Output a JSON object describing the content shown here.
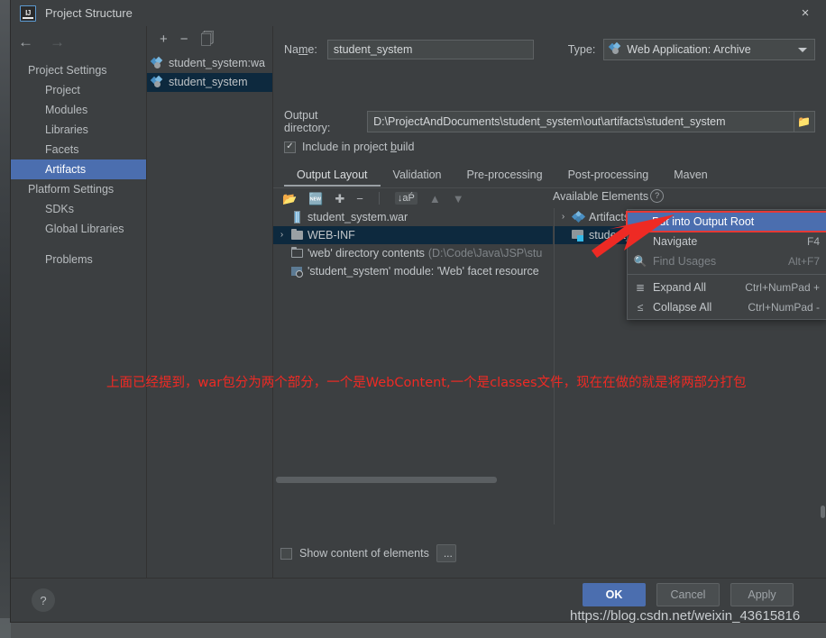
{
  "window": {
    "title": "Project Structure",
    "app_icon": "intellij-idea-icon",
    "close_label": "×"
  },
  "nav": {
    "back_icon": "arrow-left-icon",
    "forward_icon": "arrow-right-icon",
    "items": [
      {
        "label": "Project Settings",
        "type": "group",
        "selected": false
      },
      {
        "label": "Project",
        "type": "child",
        "selected": false
      },
      {
        "label": "Modules",
        "type": "child",
        "selected": false
      },
      {
        "label": "Libraries",
        "type": "child",
        "selected": false
      },
      {
        "label": "Facets",
        "type": "child",
        "selected": false
      },
      {
        "label": "Artifacts",
        "type": "child",
        "selected": true
      },
      {
        "label": "Platform Settings",
        "type": "group",
        "selected": false
      },
      {
        "label": "SDKs",
        "type": "child",
        "selected": false
      },
      {
        "label": "Global Libraries",
        "type": "child",
        "selected": false
      },
      {
        "label": "Problems",
        "type": "child",
        "selected": false
      }
    ]
  },
  "artifacts_panel": {
    "toolbar": {
      "add": "+",
      "remove": "−",
      "copy": "copy-icon"
    },
    "items": [
      {
        "label": "student_system:wa",
        "selected": false
      },
      {
        "label": "student_system",
        "selected": true
      }
    ]
  },
  "form": {
    "name_label": "Na",
    "name_label_underline": "m",
    "name_label_rest": "e:",
    "name_value": "student_system",
    "type_label": "Type:",
    "type_value": "Web Application: Archive",
    "output_dir_label": "Output directory:",
    "output_dir_value": "D:\\ProjectAndDocuments\\student_system\\out\\artifacts\\student_system",
    "browse_icon": "folder-browse-icon",
    "include_checkbox_checked": true,
    "include_label_pre": "Include in project ",
    "include_label_mnemonic": "b",
    "include_label_post": "uild"
  },
  "tabs": [
    {
      "label": "Output Layout",
      "active": true
    },
    {
      "label": "Validation",
      "active": false
    },
    {
      "label": "Pre-processing",
      "active": false
    },
    {
      "label": "Post-processing",
      "active": false
    },
    {
      "label": "Maven",
      "active": false
    }
  ],
  "layout_toolbar": {
    "add_dir_icon": "add-directory-icon",
    "add_archive_icon": "add-archive-icon",
    "plus_icon": "plus-icon",
    "minus_icon": "minus-icon",
    "sort_icon": "sort-az-icon",
    "up_icon": "move-up-icon",
    "down_icon": "move-down-icon",
    "available_elements_label": "Available Elements",
    "help_icon": "question-mark-icon"
  },
  "output_tree": [
    {
      "label": "student_system.war",
      "suffix": "",
      "icon": "jar-icon",
      "indent": 0,
      "chevron": "",
      "selected": false
    },
    {
      "label": "WEB-INF",
      "suffix": "",
      "icon": "folder-icon",
      "indent": 0,
      "chevron": "›",
      "selected": true
    },
    {
      "label": "'web' directory contents",
      "suffix": "(D:\\Code\\Java\\JSP\\stu",
      "icon": "folder-open-icon",
      "indent": 1,
      "chevron": "",
      "selected": false
    },
    {
      "label": "'student_system' module: 'Web' facet resource",
      "suffix": "",
      "icon": "facet-icon",
      "indent": 1,
      "chevron": "",
      "selected": false
    }
  ],
  "available_tree": [
    {
      "label": "Artifacts",
      "icon": "artifact-icon",
      "chevron": "›",
      "selected": false
    },
    {
      "label": "student_s",
      "icon": "module-folder-icon",
      "chevron": "",
      "selected": true
    }
  ],
  "context_menu": {
    "items": [
      {
        "label": "Put into Output Root",
        "key": "",
        "icon": "",
        "highlight": true,
        "disabled": false,
        "separator_after": false
      },
      {
        "label": "Navigate",
        "key": "F4",
        "icon": "",
        "highlight": false,
        "disabled": false,
        "separator_after": false
      },
      {
        "label": "Find Usages",
        "key": "Alt+F7",
        "icon": "search-icon",
        "highlight": false,
        "disabled": true,
        "separator_after": true
      },
      {
        "label": "Expand All",
        "key": "Ctrl+NumPad +",
        "icon": "expand-all-icon",
        "highlight": false,
        "disabled": false,
        "separator_after": false
      },
      {
        "label": "Collapse All",
        "key": "Ctrl+NumPad -",
        "icon": "collapse-all-icon",
        "highlight": false,
        "disabled": false,
        "separator_after": false
      }
    ]
  },
  "bottom_options": {
    "show_content_checked": false,
    "show_content_label": "Show content of elements",
    "dots_label": "..."
  },
  "footer": {
    "help_label": "?",
    "ok_label": "OK",
    "cancel_label": "Cancel",
    "apply_label": "Apply"
  },
  "annotation": {
    "text": "上面已经提到，war包分为两个部分，一个是WebContent,一个是classes文件，现在在做的就是将两部分打包",
    "color": "#ee2a24"
  },
  "watermark": {
    "text": "https://blog.csdn.net/weixin_43615816"
  },
  "colors": {
    "dialog_bg": "#3c3f41",
    "selection_blue": "#4b6eaf",
    "tree_selection": "#0d293e",
    "annotation_red": "#ee2a24",
    "accent_icon_blue": "#4a90c4"
  }
}
